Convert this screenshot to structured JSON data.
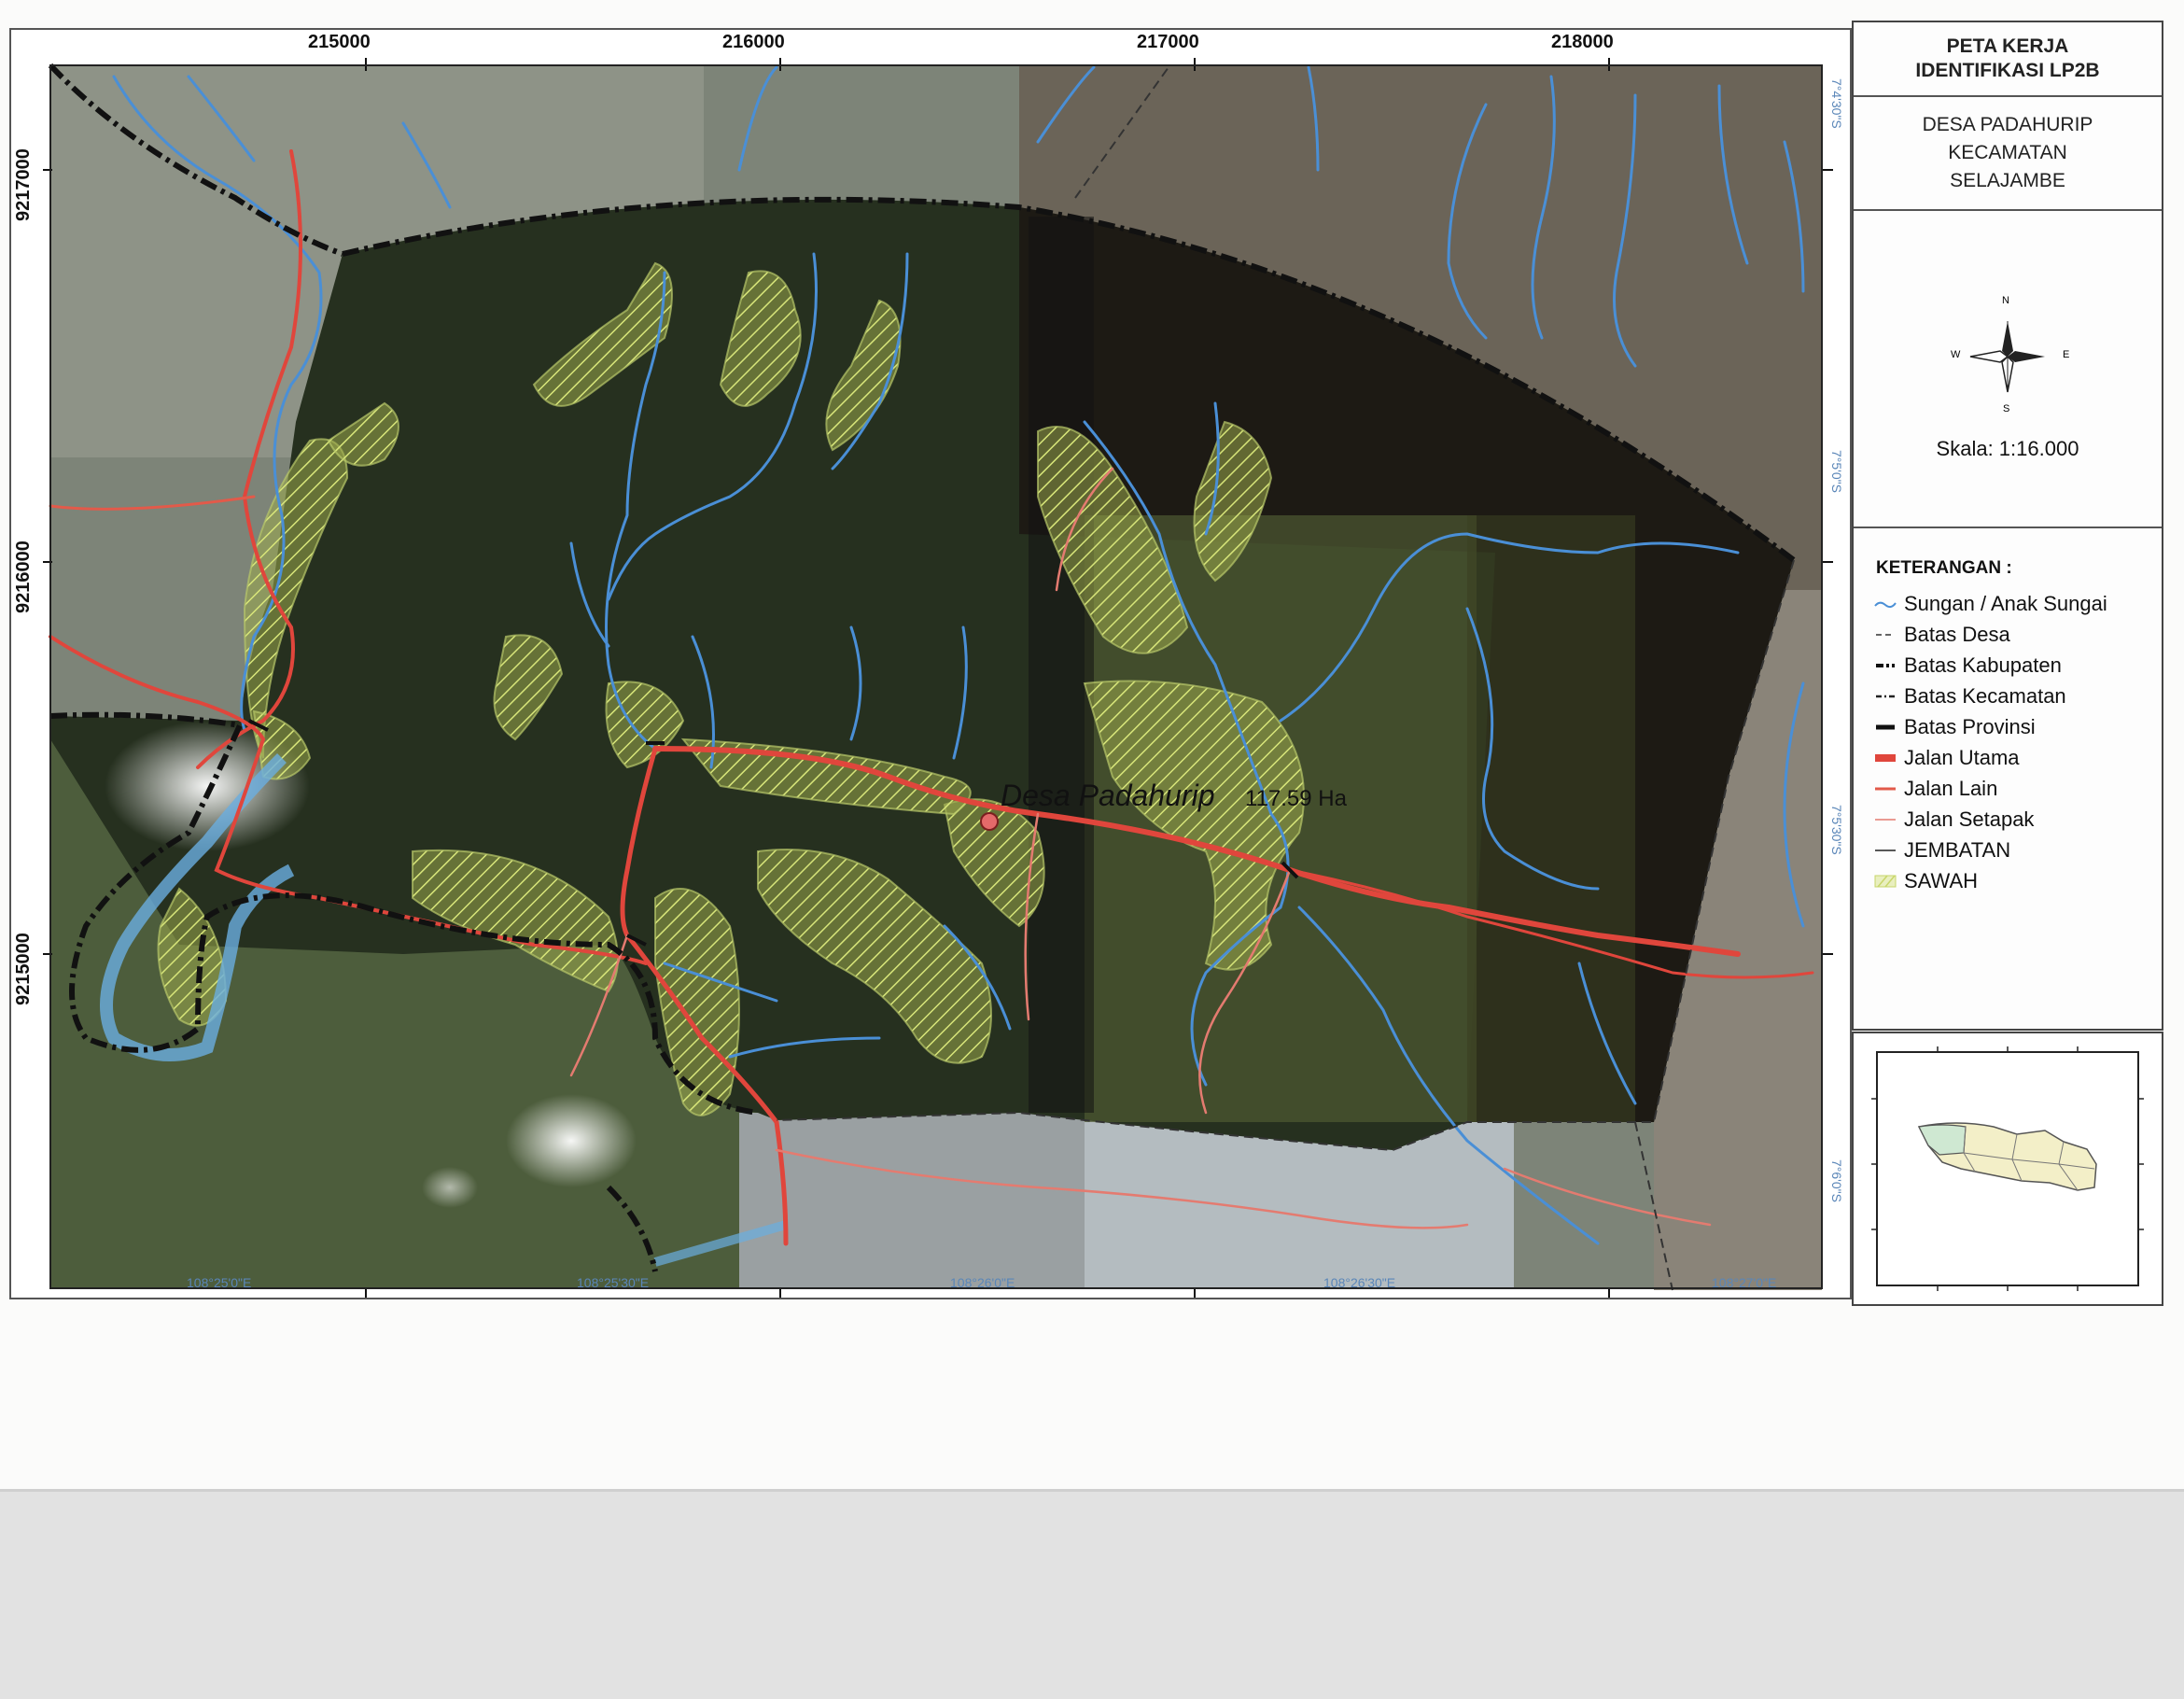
{
  "title": {
    "line1": "PETA KERJA",
    "line2": "IDENTIFIKASI LP2B"
  },
  "subtitle": {
    "line1": "DESA PADAHURIP",
    "line2": "KECAMATAN",
    "line3": "SELAJAMBE"
  },
  "compass": {
    "n": "N",
    "s": "S",
    "e": "E",
    "w": "W"
  },
  "scale": "Skala: 1:16.000",
  "legend": {
    "heading": "KETERANGAN :",
    "items": [
      {
        "label": "Sungan / Anak Sungai",
        "symbol": "river",
        "color": "#4a8fd6"
      },
      {
        "label": "Batas Desa",
        "symbol": "dash-thin",
        "color": "#333333"
      },
      {
        "label": "Batas Kabupaten",
        "symbol": "dash-thick",
        "color": "#111111"
      },
      {
        "label": "Batas Kecamatan",
        "symbol": "dash-medium",
        "color": "#222222"
      },
      {
        "label": "Batas Provinsi",
        "symbol": "bar-thick",
        "color": "#111111"
      },
      {
        "label": "Jalan Utama",
        "symbol": "road-main",
        "color": "#e0463c"
      },
      {
        "label": "Jalan Lain",
        "symbol": "road-other",
        "color": "#e25a4a"
      },
      {
        "label": "Jalan Setapak",
        "symbol": "road-path",
        "color": "#e47b70"
      },
      {
        "label": "JEMBATAN",
        "symbol": "bridge",
        "color": "#222222"
      },
      {
        "label": "SAWAH",
        "symbol": "hatch",
        "color": "#c8d66a"
      }
    ]
  },
  "grid": {
    "eastings": [
      "215000",
      "216000",
      "217000",
      "218000"
    ],
    "northings": [
      "9217000",
      "9216000",
      "9215000"
    ],
    "longitudes": [
      "108°25'0\"E",
      "108°25'30\"E",
      "108°26'0\"E",
      "108°26'30\"E",
      "108°27'0\"E"
    ],
    "latitudes": [
      "7°4'30\"S",
      "7°5'0\"S",
      "7°5'30\"S",
      "7°6'0\"S"
    ]
  },
  "village": {
    "name": "Desa Padahurip",
    "area": "117.59 Ha"
  },
  "colors": {
    "river": "#4a8fd6",
    "road": "#e0463c",
    "boundary": "#111111",
    "sawah": "#c8d66a"
  }
}
